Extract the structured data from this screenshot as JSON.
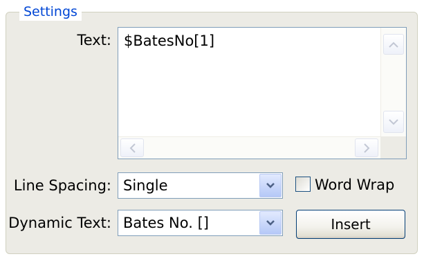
{
  "settings": {
    "group_title": "Settings",
    "text_label": "Text:",
    "text_value": "$BatesNo[1]",
    "line_spacing_label": "Line Spacing:",
    "line_spacing_value": "Single",
    "word_wrap_label": "Word Wrap",
    "word_wrap_checked": false,
    "dynamic_text_label": "Dynamic Text:",
    "dynamic_text_value": "Bates No. []",
    "insert_button_label": "Insert"
  },
  "icons": {
    "scroll_up": "chevron-up-icon",
    "scroll_down": "chevron-down-icon",
    "scroll_left": "chevron-left-icon",
    "scroll_right": "chevron-right-icon",
    "dropdown": "dropdown-arrow-icon"
  },
  "colors": {
    "group_title": "#0046d5",
    "field_border": "#7f9db9",
    "panel_background": "#ecebe5"
  }
}
